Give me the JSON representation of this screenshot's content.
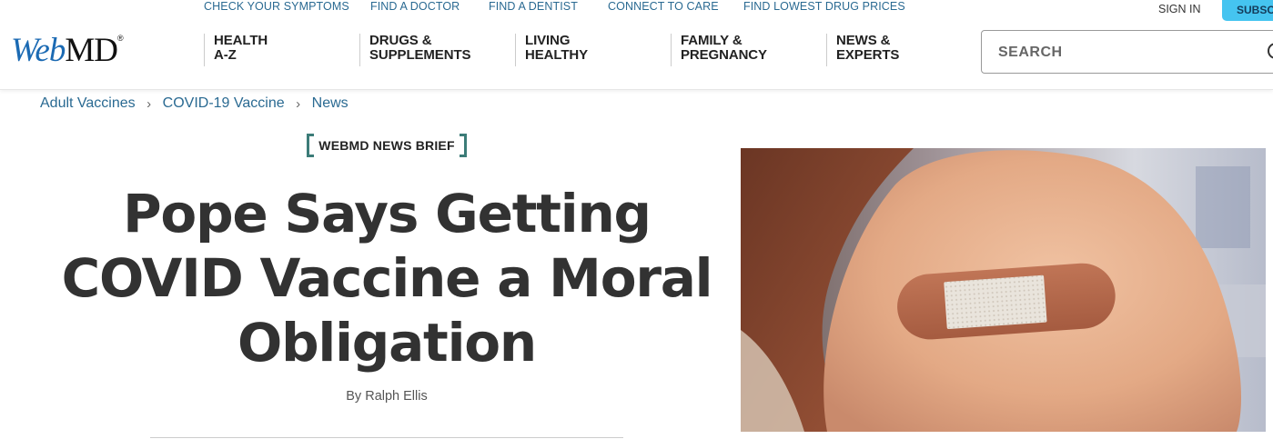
{
  "utility_nav": [
    {
      "label": "CHECK YOUR SYMPTOMS"
    },
    {
      "label": "FIND A DOCTOR"
    },
    {
      "label": "FIND A DENTIST"
    },
    {
      "label": "CONNECT TO CARE"
    },
    {
      "label": "FIND LOWEST DRUG PRICES"
    }
  ],
  "account": {
    "sign_in": "SIGN IN",
    "subscribe": "SUBSCR"
  },
  "logo": {
    "part1": "Web",
    "part2": "MD",
    "reg": "®"
  },
  "main_nav": [
    {
      "line1": "HEALTH",
      "line2": "A-Z"
    },
    {
      "line1": "DRUGS &",
      "line2": "SUPPLEMENTS"
    },
    {
      "line1": "LIVING",
      "line2": "HEALTHY"
    },
    {
      "line1": "FAMILY &",
      "line2": "PREGNANCY"
    },
    {
      "line1": "NEWS &",
      "line2": "EXPERTS"
    }
  ],
  "search": {
    "placeholder": "SEARCH",
    "icon": "search-icon"
  },
  "breadcrumb": [
    {
      "label": "Adult Vaccines"
    },
    {
      "label": "COVID-19 Vaccine"
    },
    {
      "label": "News"
    }
  ],
  "breadcrumb_separator": "›",
  "article": {
    "badge": "WEBMD NEWS BRIEF",
    "headline": "Pope Says Getting COVID Vaccine a Moral Obligation",
    "byline_prefix": "By",
    "author": "Ralph Ellis"
  },
  "colors": {
    "brand_blue": "#1b6ab3",
    "link_blue": "#2a6a92",
    "subscribe_cyan": "#45c4f0",
    "badge_teal": "#3c7c78",
    "headline": "#323232"
  }
}
